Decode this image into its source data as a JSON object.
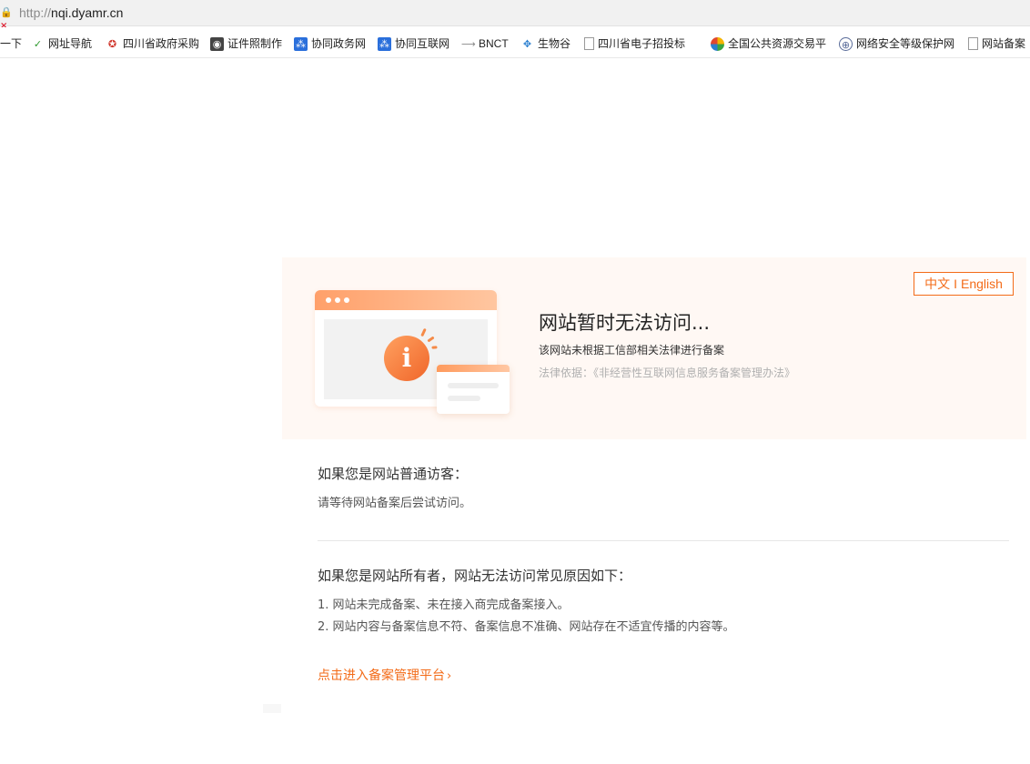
{
  "browser": {
    "url_scheme": "http://",
    "url_host": "nqi.dyamr.cn",
    "bookmarks": [
      {
        "label": "一下",
        "icon": "none"
      },
      {
        "label": "网址导航",
        "icon": "hao-icon"
      },
      {
        "label": "四川省政府采购",
        "icon": "emblem-icon"
      },
      {
        "label": "证件照制作",
        "icon": "camera-icon"
      },
      {
        "label": "协同政务网",
        "icon": "xietong-icon"
      },
      {
        "label": "协同互联网",
        "icon": "xietong-icon"
      },
      {
        "label": "BNCT",
        "icon": "arrow-icon"
      },
      {
        "label": "生物谷",
        "icon": "diamond-icon"
      },
      {
        "label": "四川省电子招投标",
        "icon": "document-icon"
      },
      {
        "label": "全国公共资源交易平",
        "icon": "ring-icon"
      },
      {
        "label": "网络安全等级保护网",
        "icon": "globe-icon"
      },
      {
        "label": "网站备案",
        "icon": "document-icon"
      }
    ]
  },
  "hero": {
    "lang_zh": "中文",
    "lang_sep": "I",
    "lang_en": "English",
    "title": "网站暂时无法访问...",
    "subtitle": "该网站未根据工信部相关法律进行备案",
    "law": "法律依据：《非经营性互联网信息服务备案管理办法》",
    "illustration_icon": "info-icon"
  },
  "visitor": {
    "heading": "如果您是网站普通访客：",
    "text": "请等待网站备案后尝试访问。"
  },
  "owner": {
    "heading": "如果您是网站所有者，网站无法访问常见原因如下：",
    "reasons": [
      "1. 网站未完成备案、未在接入商完成备案接入。",
      "2. 网站内容与备案信息不符、备案信息不准确、网站存在不适宜传播的内容等。"
    ]
  },
  "link": {
    "label": "点击进入备案管理平台",
    "chevron": "›"
  },
  "colors": {
    "accent": "#f36b18",
    "hero_bg": "#fff8f4"
  }
}
